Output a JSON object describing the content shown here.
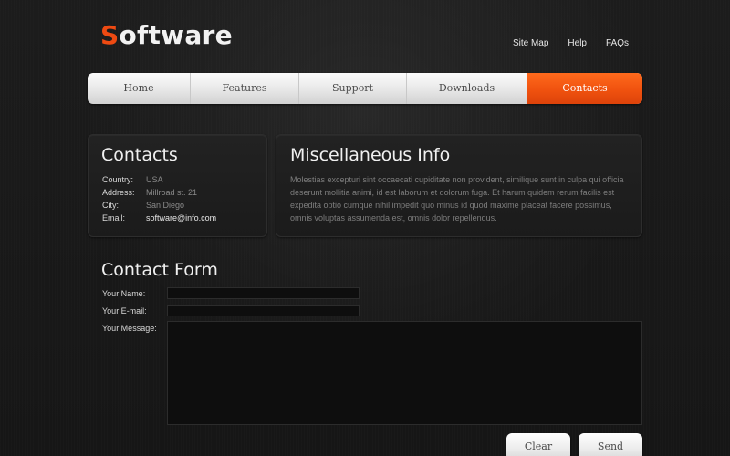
{
  "header": {
    "logo_first_letter": "S",
    "logo_rest": "oftware",
    "top_links": [
      "Site Map",
      "Help",
      "FAQs"
    ]
  },
  "nav": {
    "items": [
      {
        "label": "Home",
        "active": false
      },
      {
        "label": "Features",
        "active": false
      },
      {
        "label": "Support",
        "active": false
      },
      {
        "label": "Downloads",
        "active": false
      },
      {
        "label": "Contacts",
        "active": true
      }
    ]
  },
  "contacts": {
    "title": "Contacts",
    "rows": [
      {
        "label": "Country:",
        "value": "USA"
      },
      {
        "label": "Address:",
        "value": "Millroad st. 21"
      },
      {
        "label": "City:",
        "value": "San Diego"
      },
      {
        "label": "Email:",
        "value": "software@info.com"
      }
    ]
  },
  "misc": {
    "title": "Miscellaneous Info",
    "text": "Molestias excepturi sint occaecati cupiditate non provident, similique sunt in culpa qui officia deserunt mollitia animi, id est laborum et dolorum fuga. Et harum quidem rerum facilis est expedita optio cumque nihil impedit quo minus id quod maxime placeat facere possimus, omnis voluptas assumenda est, omnis dolor repellendus."
  },
  "form": {
    "title": "Contact Form",
    "name_label": "Your Name:",
    "email_label": "Your E-mail:",
    "message_label": "Your Message:",
    "name_value": "",
    "email_value": "",
    "message_value": "",
    "clear_label": "Clear",
    "send_label": "Send"
  },
  "colors": {
    "accent": "#ee4a12",
    "background": "#1a1a1a",
    "nav_active": "#f0520f"
  }
}
